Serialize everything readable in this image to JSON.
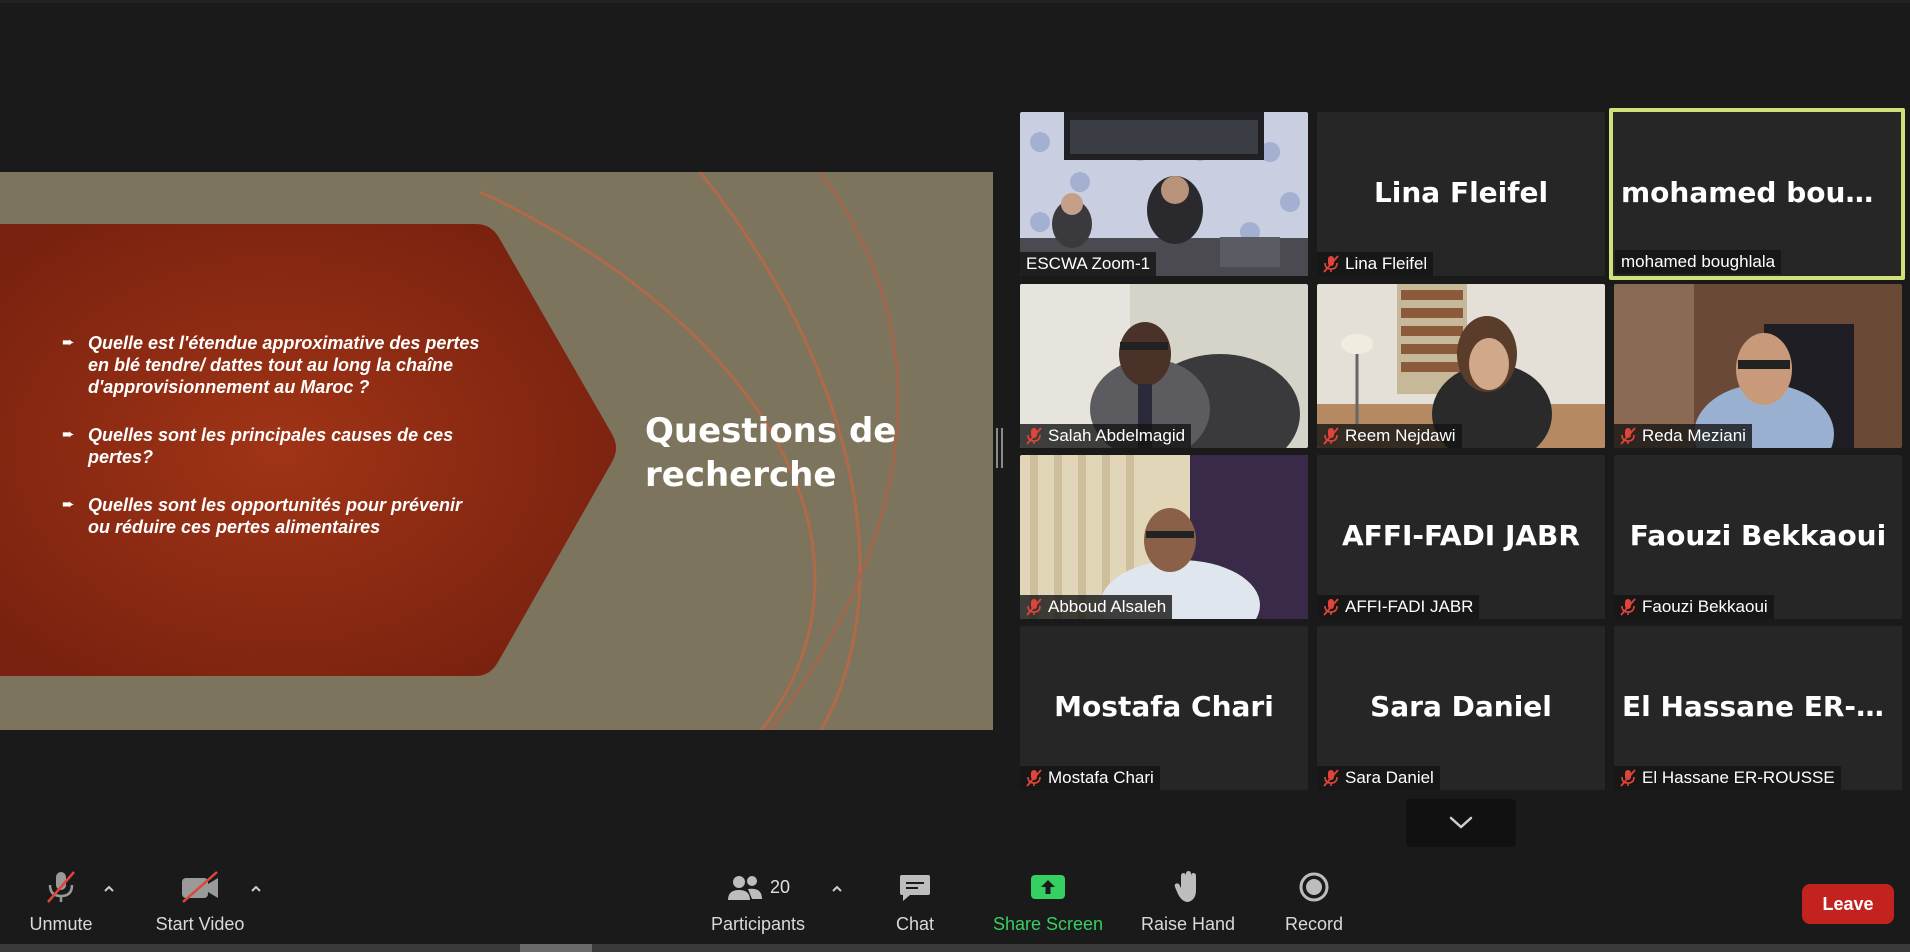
{
  "slide": {
    "bullets": [
      "Quelle est l'étendue approximative des pertes en blé tendre/ dattes tout au long la chaîne d'approvisionnement au Maroc ?",
      "Quelles sont les principales causes de ces pertes?",
      "Quelles sont les opportunités pour prévenir ou réduire ces pertes alimentaires"
    ],
    "title": "Questions de recherche",
    "colors": {
      "background": "#7c745c",
      "banner": "#8a2a14",
      "lines": "#b06a4a"
    }
  },
  "gallery": {
    "tiles": [
      {
        "name": "ESCWA Zoom-1",
        "big": "",
        "muted": false,
        "video": true,
        "active": false
      },
      {
        "name": "Lina Fleifel",
        "big": "Lina Fleifel",
        "muted": true,
        "video": false,
        "active": false
      },
      {
        "name": "mohamed boughlala",
        "big": "mohamed  boug...",
        "muted": false,
        "video": false,
        "active": true
      },
      {
        "name": "Salah Abdelmagid",
        "big": "",
        "muted": true,
        "video": true,
        "active": false
      },
      {
        "name": "Reem Nejdawi",
        "big": "",
        "muted": true,
        "video": true,
        "active": false
      },
      {
        "name": "Reda Meziani",
        "big": "",
        "muted": true,
        "video": true,
        "active": false
      },
      {
        "name": "Abboud Alsaleh",
        "big": "",
        "muted": true,
        "video": true,
        "active": false
      },
      {
        "name": "AFFI-FADI JABR",
        "big": "AFFI-FADI JABR",
        "muted": true,
        "video": false,
        "active": false
      },
      {
        "name": "Faouzi Bekkaoui",
        "big": "Faouzi Bekkaoui",
        "muted": true,
        "video": false,
        "active": false
      },
      {
        "name": "Mostafa Chari",
        "big": "Mostafa Chari",
        "muted": true,
        "video": false,
        "active": false
      },
      {
        "name": "Sara Daniel",
        "big": "Sara Daniel",
        "muted": true,
        "video": false,
        "active": false
      },
      {
        "name": "El Hassane ER-ROUSSE",
        "big": "El  Hassane  ER-R...",
        "muted": true,
        "video": false,
        "active": false
      }
    ],
    "active_border_color": "#cfe27a",
    "mute_icon_color": "#e0443a"
  },
  "toolbar": {
    "unmute": "Unmute",
    "start_video": "Start Video",
    "participants": "Participants",
    "participants_count": "20",
    "chat": "Chat",
    "share_screen": "Share Screen",
    "raise_hand": "Raise Hand",
    "record": "Record",
    "leave": "Leave",
    "share_color": "#35d061",
    "leave_color": "#c4221f"
  }
}
